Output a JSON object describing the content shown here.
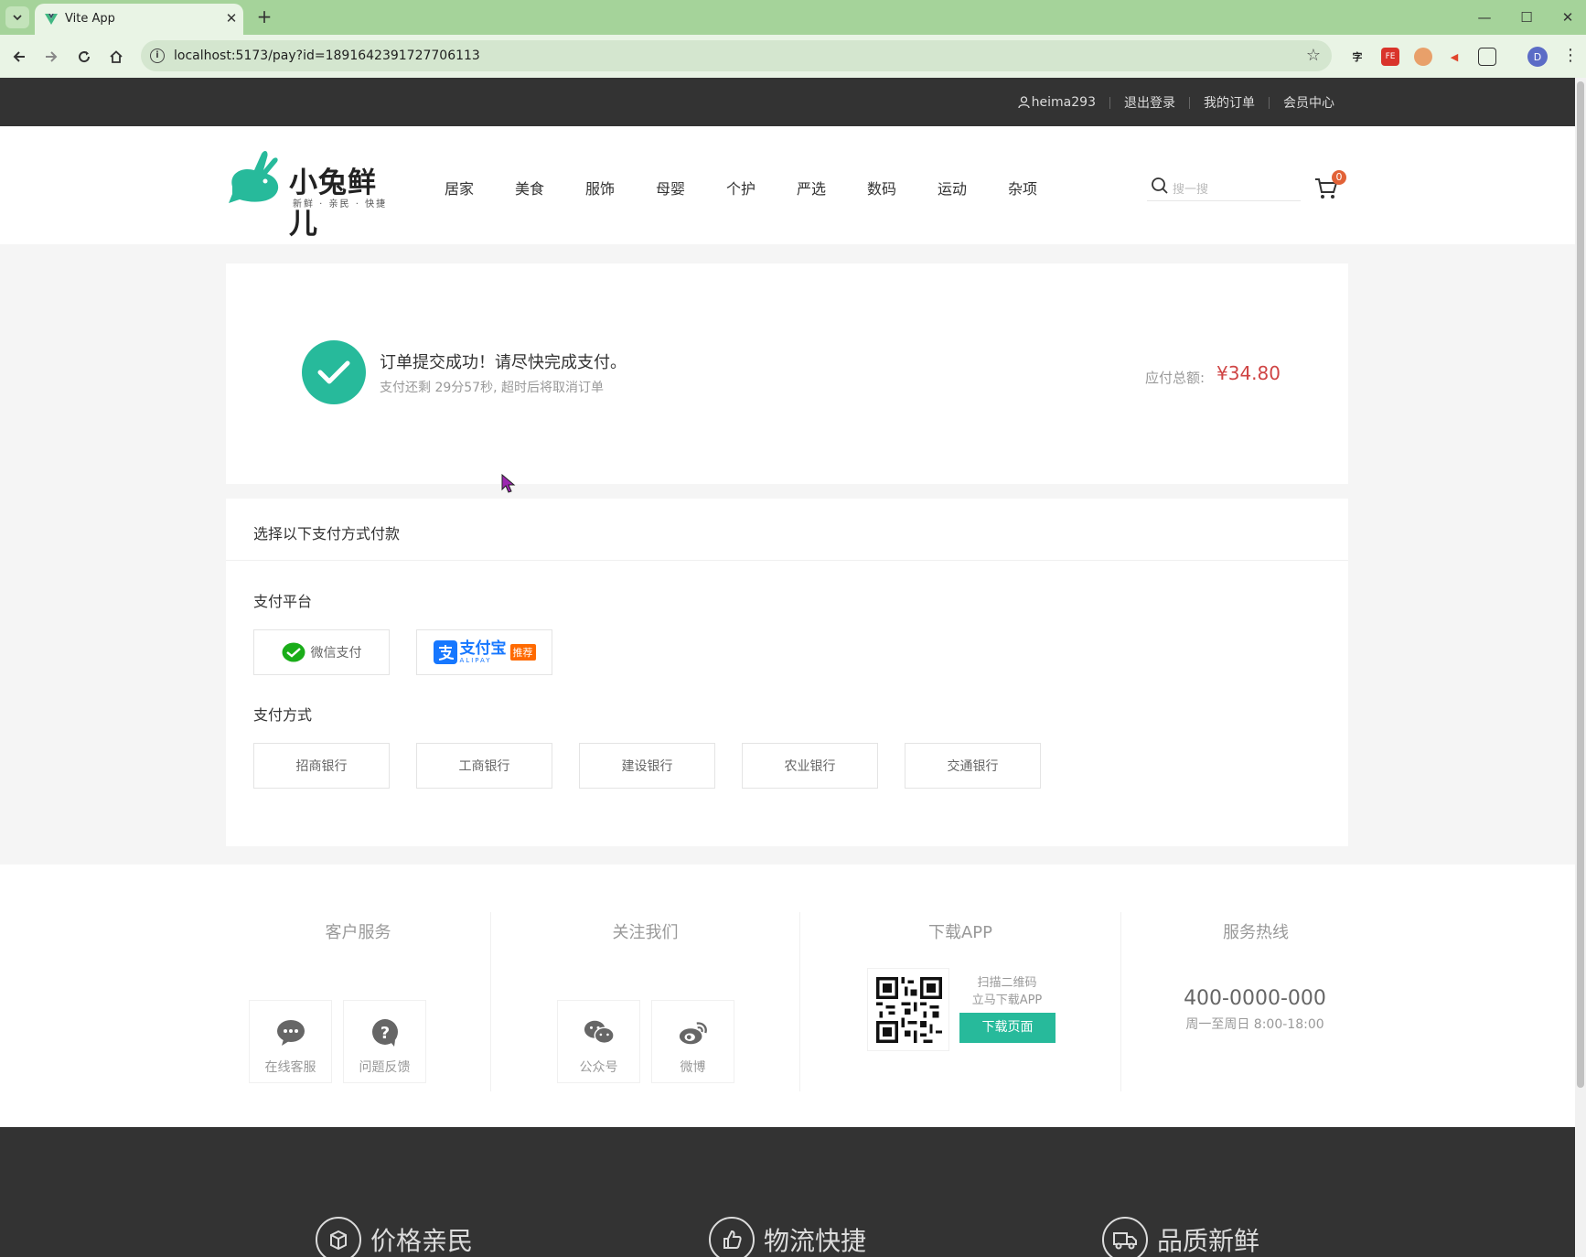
{
  "browser": {
    "tab_title": "Vite App",
    "url": "localhost:5173/pay?id=1891642391727706113",
    "profile_initial": "D",
    "ext_translate": "字"
  },
  "topnav": {
    "username": "heima293",
    "logout": "退出登录",
    "my_orders": "我的订单",
    "member_center": "会员中心"
  },
  "header": {
    "logo_text": "小兔鲜儿",
    "logo_sub": "新鲜 · 亲民 · 快捷",
    "nav": [
      "居家",
      "美食",
      "服饰",
      "母婴",
      "个护",
      "严选",
      "数码",
      "运动",
      "杂项"
    ],
    "search_placeholder": "搜一搜",
    "cart_count": "0"
  },
  "order": {
    "title": "订单提交成功！请尽快完成支付。",
    "subtitle": "支付还剩 29分57秒, 超时后将取消订单",
    "amount_label": "应付总额:",
    "amount": "¥34.80"
  },
  "payment": {
    "heading": "选择以下支付方式付款",
    "platform_title": "支付平台",
    "wechat_label": "微信支付",
    "alipay_cn": "支付宝",
    "alipay_en": "ALIPAY",
    "alipay_tag": "推荐",
    "method_title": "支付方式",
    "banks": [
      "招商银行",
      "工商银行",
      "建设银行",
      "农业银行",
      "交通银行"
    ]
  },
  "footer": {
    "service_title": "客户服务",
    "online_service": "在线客服",
    "feedback": "问题反馈",
    "follow_title": "关注我们",
    "wechat_official": "公众号",
    "weibo": "微博",
    "app_title": "下载APP",
    "app_line1": "扫描二维码",
    "app_line2": "立马下载APP",
    "download_button": "下载页面",
    "hotline_title": "服务热线",
    "hotline_number": "400-0000-000",
    "hotline_hours": "周一至周日 8:00-18:00",
    "promises": [
      "价格亲民",
      "物流快捷",
      "品质新鲜"
    ]
  },
  "colors": {
    "brand_green": "#27ba9b",
    "price_red": "#cf4444",
    "tabbar_green": "#a5d39a"
  }
}
